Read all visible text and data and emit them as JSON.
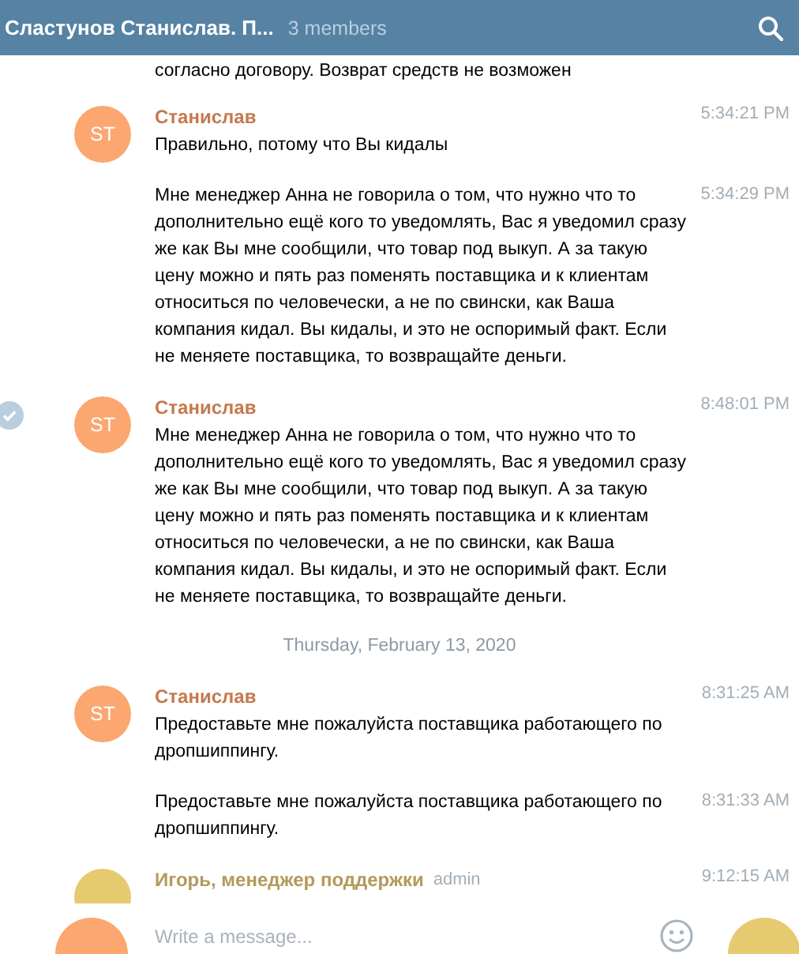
{
  "header": {
    "title": "Сластунов Станислав. П...",
    "members": "3 members"
  },
  "feed": [
    {
      "kind": "fragment",
      "text": "согласно договору. Возврат средств не возможен"
    },
    {
      "kind": "group",
      "avatar": {
        "initials": "ST",
        "color": "#fba76f"
      },
      "sender": {
        "name": "Станислав",
        "color": "#c47a4d"
      },
      "selected": false,
      "messages": [
        {
          "text": "Правильно, потому что Вы кидалы",
          "time": "5:34:21 PM"
        },
        {
          "text": "Мне менеджер Анна не говорила о том, что нужно что то дополнительно ещё кого то уведомлять, Вас я уведомил сразу же как Вы мне сообщили, что товар под выкуп. А за такую цену можно и пять раз поменять поставщика и к клиентам относиться по человечески, а не по свински, как Ваша компания кидал. Вы кидалы, и это не оспоримый факт. Если не меняете поставщика, то возвращайте деньги.",
          "time": "5:34:29 PM"
        }
      ]
    },
    {
      "kind": "group",
      "avatar": {
        "initials": "ST",
        "color": "#fba76f"
      },
      "sender": {
        "name": "Станислав",
        "color": "#c47a4d"
      },
      "selected": true,
      "messages": [
        {
          "text": "Мне менеджер Анна не говорила о том, что нужно что то дополнительно ещё кого то уведомлять, Вас я уведомил сразу же как Вы мне сообщили, что товар под выкуп. А за такую цену можно и пять раз поменять поставщика и к клиентам относиться по человечески, а не по свински, как Ваша компания кидал. Вы кидалы, и это не оспоримый факт. Если не меняете поставщика, то возвращайте деньги.",
          "time": "8:48:01 PM"
        }
      ]
    },
    {
      "kind": "date",
      "text": "Thursday, February 13, 2020"
    },
    {
      "kind": "group",
      "avatar": {
        "initials": "ST",
        "color": "#fba76f"
      },
      "sender": {
        "name": "Станислав",
        "color": "#c47a4d"
      },
      "selected": false,
      "messages": [
        {
          "text": "Предоставьте мне пожалуйста поставщика работающего по дропшиппингу.",
          "time": "8:31:25 AM"
        },
        {
          "text": "Предоставьте мне пожалуйста поставщика работающего по дропшиппингу.",
          "time": "8:31:33 AM"
        }
      ]
    },
    {
      "kind": "group",
      "avatar": {
        "color": "#e5ca70"
      },
      "sender": {
        "name": "Игорь, менеджер поддержки",
        "color": "#b39a5a"
      },
      "badge": "admin",
      "selected": false,
      "messages": [
        {
          "time": "9:12:15 AM"
        }
      ]
    }
  ],
  "compose": {
    "placeholder": "Write a message..."
  },
  "overlay_avatars": [
    {
      "color": "#fba76f"
    },
    {
      "color": "#e5ca70"
    }
  ]
}
